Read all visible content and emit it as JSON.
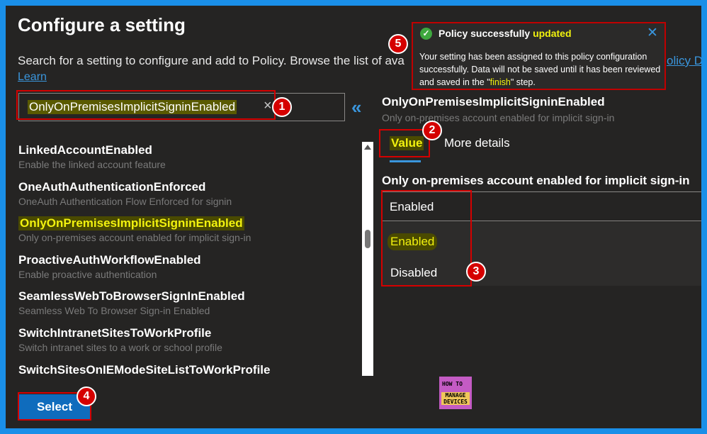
{
  "header": {
    "title": "Configure a setting",
    "description": "Search for a setting to configure and add to Policy. Browse the list of ava",
    "learn_link": "Learn",
    "policy_link": "olicy D"
  },
  "search": {
    "value": "OnlyOnPremisesImplicitSigninEnabled",
    "clear_icon": "×",
    "collapse_icon": "«"
  },
  "settings_list": [
    {
      "name": "LinkedAccountEnabled",
      "description": "Enable the linked account feature"
    },
    {
      "name": "OneAuthAuthenticationEnforced",
      "description": "OneAuth Authentication Flow Enforced for signin"
    },
    {
      "name": "OnlyOnPremisesImplicitSigninEnabled",
      "description": "Only on-premises account enabled for implicit sign-in"
    },
    {
      "name": "ProactiveAuthWorkflowEnabled",
      "description": "Enable proactive authentication"
    },
    {
      "name": "SeamlessWebToBrowserSignInEnabled",
      "description": "Seamless Web To Browser Sign-in Enabled"
    },
    {
      "name": "SwitchIntranetSitesToWorkProfile",
      "description": "Switch intranet sites to a work or school profile"
    },
    {
      "name": "SwitchSitesOnIEModeSiteListToWorkProfile",
      "description": ""
    }
  ],
  "footer": {
    "select_label": "Select"
  },
  "detail": {
    "title": "OnlyOnPremisesImplicitSigninEnabled",
    "subtitle": "Only on-premises account enabled for implicit sign-in",
    "tab_value": "Value",
    "tab_more": "More details",
    "field_label": "Only on-premises account enabled for implicit sign-in",
    "selected_value": "Enabled",
    "options": [
      "Enabled",
      "Disabled"
    ]
  },
  "toast": {
    "title_prefix": "Policy successfully",
    "title_highlight": "updated",
    "body_prefix": "Your setting has been assigned to this policy configuration successfully. Data will not be saved until it has been reviewed and saved in the \"",
    "body_highlight": "finish",
    "body_suffix": "\" step.",
    "check_icon": "✓",
    "close_icon": "✕"
  },
  "badges": [
    "1",
    "2",
    "3",
    "4",
    "5"
  ],
  "logo": {
    "line1": "HOW TO",
    "line2": "MANAGE DEVICES"
  },
  "colors": {
    "background_frame": "#1a8fe8",
    "panel": "#252423",
    "highlight_text": "#f2f20e",
    "annotation_red": "#d50000",
    "accent_blue": "#0f6cbd"
  }
}
